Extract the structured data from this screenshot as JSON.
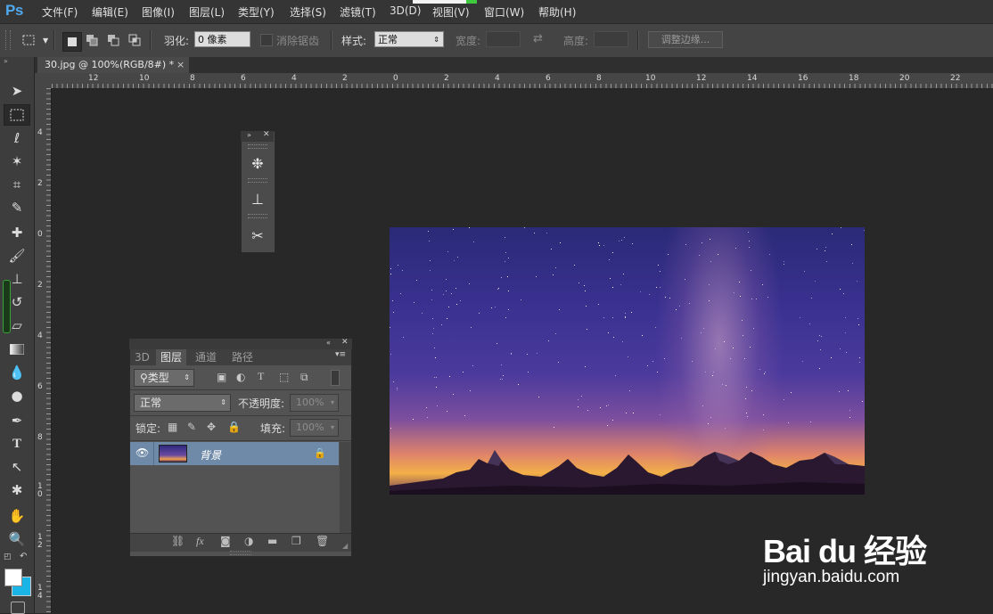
{
  "app": {
    "logo": "Ps"
  },
  "menu": [
    "文件(F)",
    "编辑(E)",
    "图像(I)",
    "图层(L)",
    "类型(Y)",
    "选择(S)",
    "滤镜(T)",
    "3D(D)",
    "视图(V)",
    "窗口(W)",
    "帮助(H)"
  ],
  "options": {
    "feather_label": "羽化:",
    "feather_value": "0 像素",
    "antialias_label": "消除锯齿",
    "style_label": "样式:",
    "style_value": "正常",
    "width_label": "宽度:",
    "height_label": "高度:",
    "refine_edge_button": "调整边缘..."
  },
  "document": {
    "tab_title": "30.jpg @ 100%(RGB/8#) *",
    "close": "×"
  },
  "rulers": {
    "horizontal": [
      "12",
      "10",
      "8",
      "6",
      "4",
      "2",
      "0",
      "2",
      "4",
      "6",
      "8",
      "10",
      "12",
      "14",
      "16",
      "18",
      "20",
      "22"
    ],
    "vertical": [
      "4",
      "2",
      "0",
      "2",
      "4",
      "6",
      "8",
      "10",
      "12",
      "14"
    ]
  },
  "layers_panel": {
    "tabs": [
      "3D",
      "图层",
      "通道",
      "路径"
    ],
    "active_tab": "图层",
    "filter_kind": "类型",
    "blend_mode": "正常",
    "opacity_label": "不透明度:",
    "opacity_value": "100%",
    "lock_label": "锁定:",
    "fill_label": "填充:",
    "fill_value": "100%",
    "layers": [
      {
        "name": "背景",
        "visible": true,
        "locked": true
      }
    ]
  },
  "watermark": {
    "logo": "Bai du 经验",
    "url": "jingyan.baidu.com"
  },
  "colors": {
    "accent": "#4fa9ef",
    "layer_selected": "#6f8aa8",
    "background": "#282828"
  }
}
